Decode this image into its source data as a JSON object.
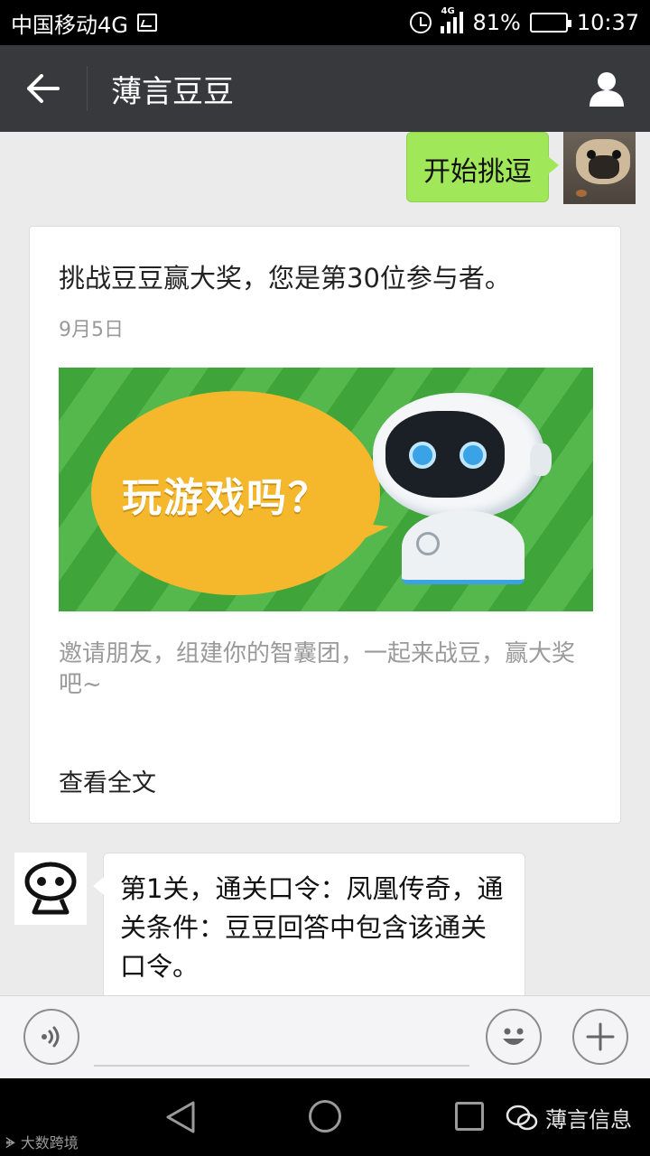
{
  "status_bar": {
    "carrier": "中国移动4G",
    "network_badge": "4G",
    "battery": "81%",
    "battery_level": 0.81,
    "time": "10:37"
  },
  "header": {
    "title": "薄言豆豆",
    "back_icon": "arrow-left-icon",
    "profile_icon": "person-icon"
  },
  "messages": {
    "outgoing": {
      "text": "开始挑逗"
    },
    "article": {
      "title": "挑战豆豆赢大奖，您是第30位参与者。",
      "date": "9月5日",
      "banner_text": "玩游戏吗？",
      "description": "邀请朋友，组建你的智囊团，一起来战豆，赢大奖吧~",
      "read_more": "查看全文"
    },
    "incoming": {
      "text": "第1关，通关口令：凤凰传奇，通关条件：豆豆回答中包含该通关口令。"
    }
  },
  "input_bar": {
    "voice_icon": "voice-icon",
    "emoji_icon": "emoji-icon",
    "plus_icon": "plus-icon",
    "placeholder": ""
  },
  "watermarks": {
    "left": "大数跨境",
    "right": "薄言信息"
  },
  "colors": {
    "header_bg": "#38393d",
    "outgoing_bubble": "#a0e75a",
    "chat_bg": "#ebebeb"
  }
}
